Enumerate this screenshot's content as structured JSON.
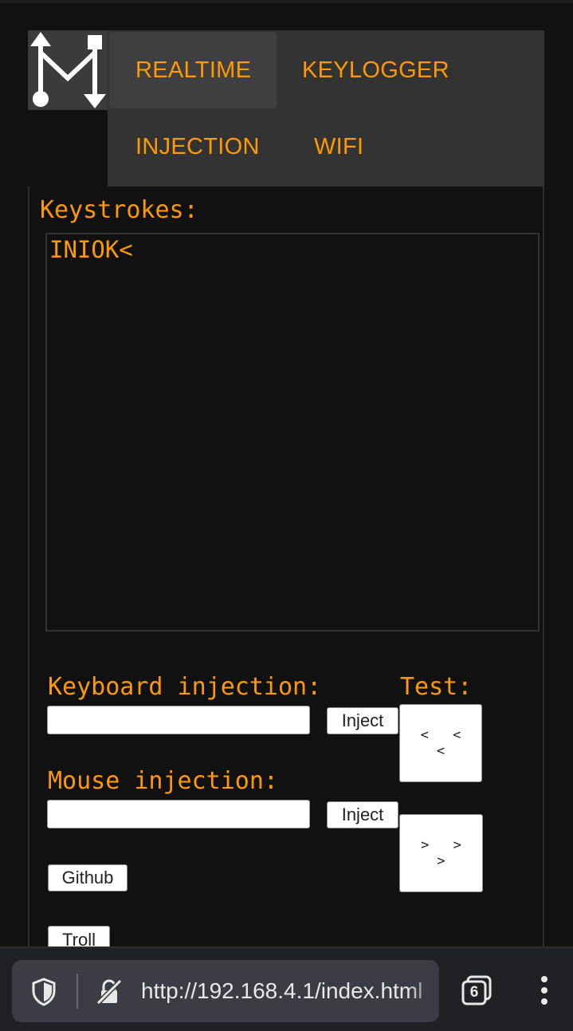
{
  "header": {
    "logo_icon": "mouse-keyboard-logo-icon",
    "tabs": [
      {
        "label": "REALTIME",
        "active": true
      },
      {
        "label": "KEYLOGGER",
        "active": false
      },
      {
        "label": "INJECTION",
        "active": false
      },
      {
        "label": "WIFI",
        "active": false
      }
    ]
  },
  "keystrokes": {
    "label": "Keystrokes:",
    "content": "INIOK<"
  },
  "keyboard_injection": {
    "label": "Keyboard injection:",
    "value": "",
    "button_label": "Inject"
  },
  "mouse_injection": {
    "label": "Mouse injection:",
    "value": "",
    "button_label": "Inject"
  },
  "test": {
    "label": "Test:",
    "left_button_label": "< < <",
    "right_button_label": "> > >"
  },
  "links": {
    "github_label": "Github",
    "troll_label": "Troll"
  },
  "browser": {
    "url": "http://192.168.4.1/index.html",
    "tab_count": "6",
    "icons": [
      "shield-icon",
      "not-secure-icon",
      "tabs-icon",
      "more-menu-icon"
    ]
  },
  "colors": {
    "accent": "#ff9900",
    "background": "#111111",
    "nav_background": "#333333"
  }
}
